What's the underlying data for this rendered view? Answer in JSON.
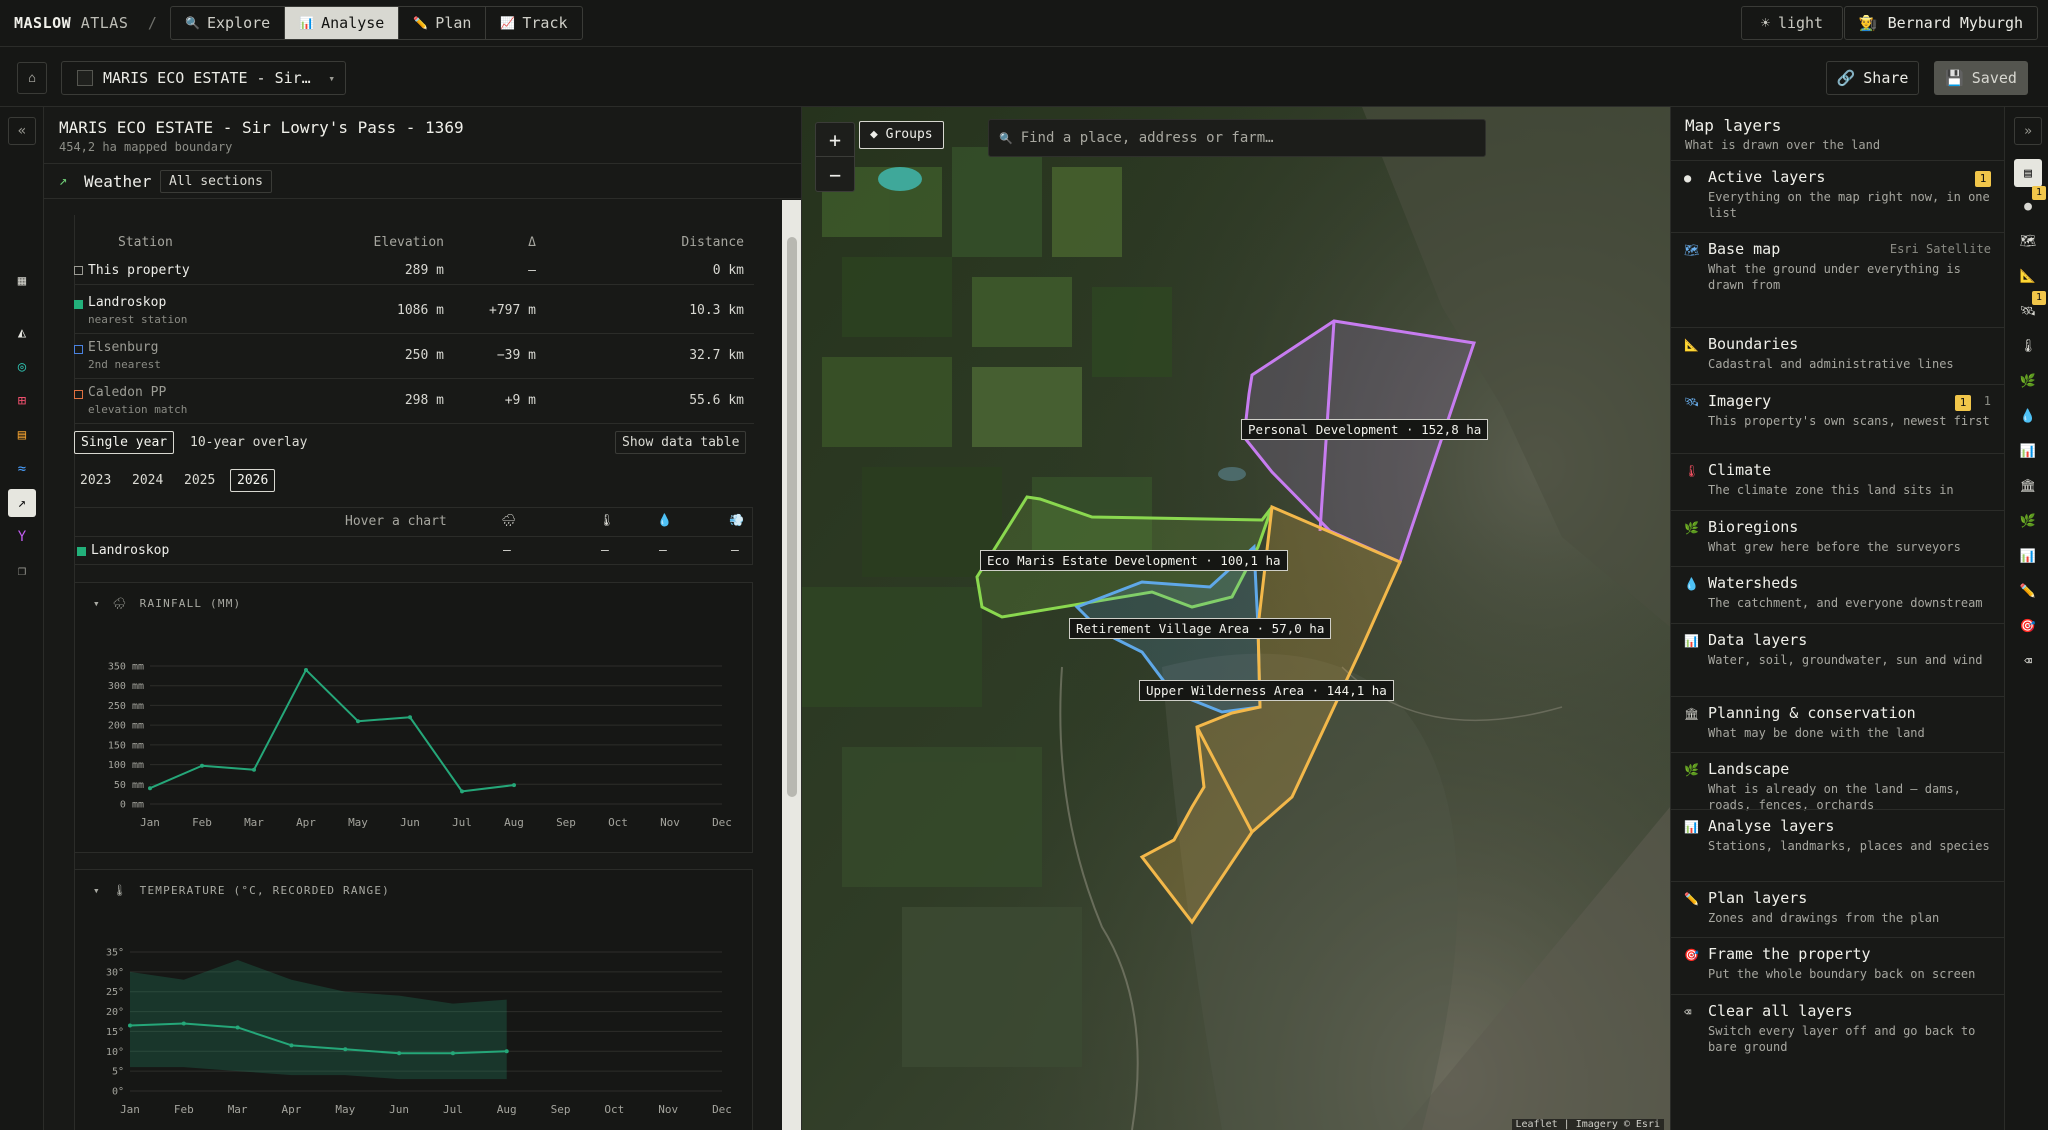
{
  "brand": {
    "name": "MASLOW",
    "sub": "ATLAS",
    "separator": "/"
  },
  "modes": [
    {
      "label": "Explore",
      "icon": "🔍"
    },
    {
      "label": "Analyse",
      "icon": "📊"
    },
    {
      "label": "Plan",
      "icon": "✏️"
    },
    {
      "label": "Track",
      "icon": "📈"
    }
  ],
  "active_mode": "Analyse",
  "theme_toggle": {
    "icon": "☀",
    "label": "light"
  },
  "user": {
    "icon": "👨‍🌾",
    "name": "Bernard Myburgh"
  },
  "project_bar": {
    "home_icon": "⌂",
    "project_name": "MARIS ECO ESTATE - Sir…",
    "dropdown_icon": "▾",
    "share_label": "Share",
    "share_icon": "🔗",
    "saved_label": "Saved",
    "saved_icon": "💾"
  },
  "left_rail": {
    "collapse_icon": "«",
    "items": [
      {
        "name": "layers-panel-icon",
        "glyph": "▦",
        "color": "#cfcfc8"
      },
      {
        "name": "terrain-icon",
        "glyph": "◭",
        "color": "#e8e8e2"
      },
      {
        "name": "compass-icon",
        "glyph": "◎",
        "color": "#2fc2b0"
      },
      {
        "name": "grid-icon",
        "glyph": "⊞",
        "color": "#f0506e"
      },
      {
        "name": "table-icon",
        "glyph": "▤",
        "color": "#f0a030"
      },
      {
        "name": "water-icon",
        "glyph": "≈",
        "color": "#4aa0ff"
      },
      {
        "name": "weather-icon",
        "glyph": "↗",
        "color": "#111111"
      },
      {
        "name": "plant-icon",
        "glyph": "Y",
        "color": "#c05cf0"
      },
      {
        "name": "copy-icon",
        "glyph": "❐",
        "color": "#9a9a93"
      }
    ]
  },
  "panel": {
    "title": "MARIS ECO ESTATE - Sir Lowry's Pass - 1369",
    "subtitle": "454,2 ha mapped boundary",
    "section_icon": "↗",
    "section": "Weather",
    "all_sections": "All sections"
  },
  "stations": {
    "headers": [
      "Station",
      "Elevation",
      "Δ",
      "Distance"
    ],
    "rows": [
      {
        "name": "This property",
        "note": "",
        "elevation": "289 m",
        "delta": "—",
        "distance": "0 km",
        "color": "#9a9a93",
        "filled": false
      },
      {
        "name": "Landroskop",
        "note": "nearest station",
        "elevation": "1086 m",
        "delta": "+797 m",
        "distance": "10.3 km",
        "color": "#22b07a",
        "filled": true
      },
      {
        "name": "Elsenburg",
        "note": "2nd nearest",
        "elevation": "250 m",
        "delta": "−39 m",
        "distance": "32.7 km",
        "color": "#4a82e0",
        "filled": false
      },
      {
        "name": "Caledon PP",
        "note": "elevation match",
        "elevation": "298 m",
        "delta": "+9 m",
        "distance": "55.6 km",
        "color": "#e07040",
        "filled": false
      }
    ]
  },
  "view_modes": {
    "single": "Single year",
    "overlay": "10-year overlay",
    "show_table": "Show data table"
  },
  "years": [
    "2023",
    "2024",
    "2025",
    "2026"
  ],
  "selected_year": "2026",
  "hover": {
    "prompt": "Hover a chart",
    "icons": [
      "🌧",
      "🌡",
      "💧",
      "💨"
    ],
    "station": "Landroskop",
    "values": [
      "—",
      "—",
      "—",
      "—"
    ]
  },
  "chart_data": [
    {
      "type": "line",
      "title": "RAINFALL (MM)",
      "icon": "🌧",
      "collapse_icon": "▾",
      "categories": [
        "Jan",
        "Feb",
        "Mar",
        "Apr",
        "May",
        "Jun",
        "Jul",
        "Aug",
        "Sep",
        "Oct",
        "Nov",
        "Dec"
      ],
      "series": [
        {
          "values": [
            40,
            97,
            87,
            340,
            210,
            220,
            32,
            48,
            null,
            null,
            null,
            null
          ],
          "color": "#25a779"
        }
      ],
      "yticks": [
        "0 mm",
        "50 mm",
        "100 mm",
        "150 mm",
        "200 mm",
        "250 mm",
        "300 mm",
        "350 mm"
      ],
      "ylim": [
        0,
        350
      ],
      "grid": true
    },
    {
      "type": "area",
      "title": "TEMPERATURE (°C, RECORDED RANGE)",
      "icon": "🌡",
      "collapse_icon": "▾",
      "categories": [
        "Jan",
        "Feb",
        "Mar",
        "Apr",
        "May",
        "Jun",
        "Jul",
        "Aug",
        "Sep",
        "Oct",
        "Nov",
        "Dec"
      ],
      "series": [
        {
          "values": [
            16.5,
            17,
            16,
            11.5,
            10.5,
            9.5,
            9.5,
            10,
            null,
            null,
            null,
            null
          ],
          "color": "#25a779"
        }
      ],
      "range": {
        "min": [
          6,
          6,
          5,
          4,
          4,
          3,
          3,
          3,
          null,
          null,
          null,
          null
        ],
        "max": [
          30,
          28,
          33,
          28,
          25,
          24,
          22,
          23,
          null,
          null,
          null,
          null
        ]
      },
      "yticks": [
        "0°",
        "5°",
        "10°",
        "15°",
        "20°",
        "25°",
        "30°",
        "35°"
      ],
      "ylim": [
        0,
        35
      ],
      "grid": true
    }
  ],
  "map": {
    "zoom_in": "+",
    "zoom_out": "−",
    "groups_label": "◆ Groups",
    "search_placeholder": "Find a place, address or farm…",
    "search_icon": "🔍",
    "zones": [
      {
        "label": "Personal Development · 152,8 ha",
        "color": "#c77cf0"
      },
      {
        "label": "Eco Maris Estate Development · 100,1 ha",
        "color": "#8ad84f"
      },
      {
        "label": "Retirement Village Area · 57,0 ha",
        "color": "#5fa8e8"
      },
      {
        "label": "Upper Wilderness Area · 144,1 ha",
        "color": "#f3b84a"
      }
    ],
    "attribution": "Leaflet | Imagery © Esri"
  },
  "layers_panel": {
    "title": "Map layers",
    "subtitle": "What is drawn over the land",
    "items": [
      {
        "icon": "●",
        "icon_color": "#e8e8e2",
        "name": "Active layers",
        "desc": "Everything on the map right now, in one list",
        "meta": "",
        "badge": "1"
      },
      {
        "icon": "🗺",
        "icon_color": "#6ab0f0",
        "name": "Base map",
        "desc": "What the ground under everything is drawn from",
        "meta": "Esri Satellite",
        "badge": ""
      },
      {
        "icon": "📐",
        "icon_color": "#cfcfc8",
        "name": "Boundaries",
        "desc": "Cadastral and administrative lines",
        "meta": "",
        "badge": ""
      },
      {
        "icon": "🛰",
        "icon_color": "#6ab0f0",
        "name": "Imagery",
        "desc": "This property's own scans, newest first",
        "meta": "1",
        "badge": "1"
      },
      {
        "icon": "🌡",
        "icon_color": "#f05060",
        "name": "Climate",
        "desc": "The climate zone this land sits in",
        "meta": "",
        "badge": ""
      },
      {
        "icon": "🌿",
        "icon_color": "#6fce77",
        "name": "Bioregions",
        "desc": "What grew here before the surveyors",
        "meta": "",
        "badge": ""
      },
      {
        "icon": "💧",
        "icon_color": "#4aa0ff",
        "name": "Watersheds",
        "desc": "The catchment, and everyone downstream",
        "meta": "",
        "badge": ""
      },
      {
        "icon": "📊",
        "icon_color": "#4aa0ff",
        "name": "Data layers",
        "desc": "Water, soil, groundwater, sun and wind",
        "meta": "",
        "badge": ""
      },
      {
        "icon": "🏛",
        "icon_color": "#cfcfc8",
        "name": "Planning & conservation",
        "desc": "What may be done with the land",
        "meta": "",
        "badge": ""
      },
      {
        "icon": "🌿",
        "icon_color": "#6fce77",
        "name": "Landscape",
        "desc": "What is already on the land — dams, roads, fences, orchards",
        "meta": "",
        "badge": ""
      },
      {
        "icon": "📊",
        "icon_color": "#4aa0ff",
        "name": "Analyse layers",
        "desc": "Stations, landmarks, places and species",
        "meta": "",
        "badge": ""
      },
      {
        "icon": "✏️",
        "icon_color": "#f1c64a",
        "name": "Plan layers",
        "desc": "Zones and drawings from the plan",
        "meta": "",
        "badge": ""
      },
      {
        "icon": "🎯",
        "icon_color": "#f05060",
        "name": "Frame the property",
        "desc": "Put the whole boundary back on screen",
        "meta": "",
        "badge": ""
      },
      {
        "icon": "⌫",
        "icon_color": "#cfcfc8",
        "name": "Clear all layers",
        "desc": "Switch every layer off and go back to bare ground",
        "meta": "",
        "badge": ""
      }
    ]
  },
  "right_rail": {
    "collapse_icon": "»",
    "items": [
      {
        "name": "layers-icon",
        "glyph": "▤",
        "badge": ""
      },
      {
        "name": "active-dot-icon",
        "glyph": "●",
        "badge": "1"
      },
      {
        "name": "basemap-icon",
        "glyph": "🗺",
        "badge": ""
      },
      {
        "name": "boundary-icon",
        "glyph": "📐",
        "badge": ""
      },
      {
        "name": "imagery-icon",
        "glyph": "🛰",
        "badge": "1"
      },
      {
        "name": "climate-icon",
        "glyph": "🌡",
        "badge": ""
      },
      {
        "name": "bioregion-icon",
        "glyph": "🌿",
        "badge": ""
      },
      {
        "name": "watershed-icon",
        "glyph": "💧",
        "badge": ""
      },
      {
        "name": "data-icon",
        "glyph": "📊",
        "badge": ""
      },
      {
        "name": "planning-icon",
        "glyph": "🏛",
        "badge": ""
      },
      {
        "name": "landscape-icon",
        "glyph": "🌿",
        "badge": ""
      },
      {
        "name": "analyse-icon",
        "glyph": "📊",
        "badge": ""
      },
      {
        "name": "plan-icon",
        "glyph": "✏️",
        "badge": ""
      },
      {
        "name": "frame-icon",
        "glyph": "🎯",
        "badge": ""
      },
      {
        "name": "clear-icon",
        "glyph": "⌫",
        "badge": ""
      }
    ]
  }
}
